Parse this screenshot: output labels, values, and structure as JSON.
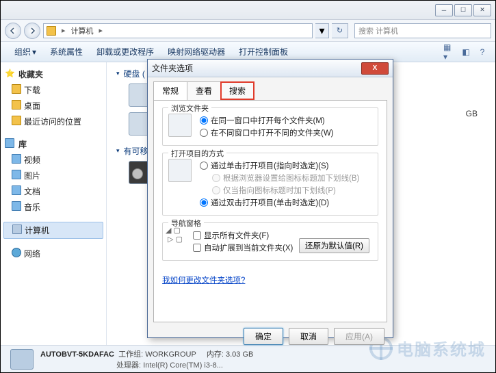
{
  "window": {
    "min_tip": "最小化",
    "max_tip": "最大化",
    "close_tip": "关闭"
  },
  "address": {
    "location": "计算机",
    "search_placeholder": "搜索 计算机"
  },
  "toolbar": {
    "organize": "组织",
    "system_props": "系统属性",
    "uninstall": "卸载或更改程序",
    "map_drive": "映射网络驱动器",
    "control_panel": "打开控制面板"
  },
  "sidebar": {
    "favorites": "收藏夹",
    "items_fav": [
      "下载",
      "桌面",
      "最近访问的位置"
    ],
    "libraries": "库",
    "items_lib": [
      "视频",
      "图片",
      "文档",
      "音乐"
    ],
    "computer": "计算机",
    "network": "网络"
  },
  "content": {
    "hard_drives": "硬盘 (",
    "removable": "有可移"
  },
  "info_panel": {
    "gb_suffix": "GB"
  },
  "status": {
    "pc_name": "AUTOBVT-5KDAFAC",
    "workgroup_label": "工作组:",
    "workgroup": "WORKGROUP",
    "mem_label": "内存:",
    "mem": "3.03 GB",
    "cpu_label": "处理器:",
    "cpu": "Intel(R) Core(TM) i3-8..."
  },
  "dialog": {
    "title": "文件夹选项",
    "tabs": {
      "general": "常规",
      "view": "查看",
      "search": "搜索"
    },
    "browse": {
      "title": "浏览文件夹",
      "same": "在同一窗口中打开每个文件夹(M)",
      "own": "在不同窗口中打开不同的文件夹(W)"
    },
    "click": {
      "title": "打开项目的方式",
      "single": "通过单击打开项目(指向时选定)(S)",
      "under_browser": "根据浏览器设置给图标标题加下划线(B)",
      "under_hover": "仅当指向图标标题时加下划线(P)",
      "double": "通过双击打开项目(单击时选定)(D)"
    },
    "nav": {
      "title": "导航窗格",
      "show_all": "显示所有文件夹(F)",
      "auto_expand": "自动扩展到当前文件夹(X)"
    },
    "restore": "还原为默认值(R)",
    "help_link": "我如何更改文件夹选项?",
    "ok": "确定",
    "cancel": "取消",
    "apply": "应用(A)"
  },
  "watermark": "电脑系统城"
}
